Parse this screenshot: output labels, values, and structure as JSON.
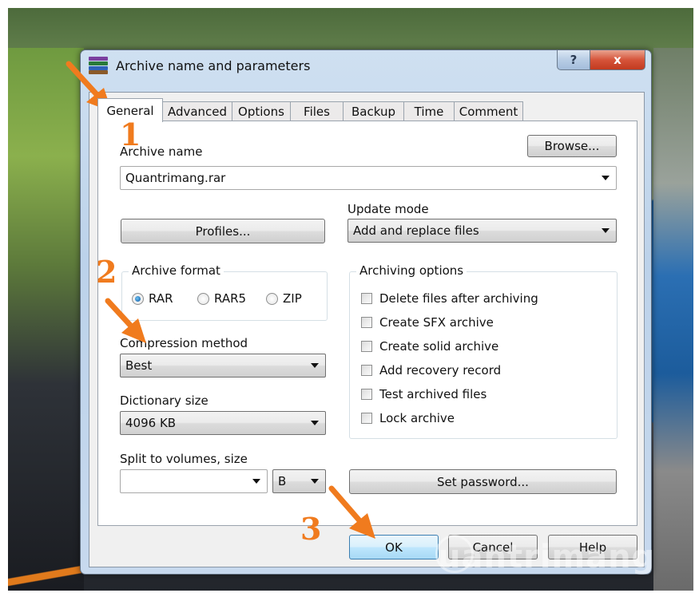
{
  "dialog": {
    "title": "Archive name and parameters",
    "help_label": "?",
    "close_label": "x"
  },
  "tabs": [
    "General",
    "Advanced",
    "Options",
    "Files",
    "Backup",
    "Time",
    "Comment"
  ],
  "general": {
    "archive_name_label": "Archive name",
    "browse_label": "Browse...",
    "archive_name_value": "Quantrimang.rar",
    "profiles_label": "Profiles...",
    "update_mode_label": "Update mode",
    "update_mode_value": "Add and replace files",
    "archive_format_title": "Archive format",
    "formats": [
      "RAR",
      "RAR5",
      "ZIP"
    ],
    "selected_format": "RAR",
    "compression_label": "Compression method",
    "compression_value": "Best",
    "dictionary_label": "Dictionary size",
    "dictionary_value": "4096 KB",
    "split_label": "Split to volumes, size",
    "split_value": "",
    "split_unit": "B",
    "archiving_options_title": "Archiving options",
    "options": [
      "Delete files after archiving",
      "Create SFX archive",
      "Create solid archive",
      "Add recovery record",
      "Test archived files",
      "Lock archive"
    ],
    "set_password_label": "Set password..."
  },
  "footer": {
    "ok_label": "OK",
    "cancel_label": "Cancel",
    "help_label": "Help"
  },
  "annotations": {
    "step1": "1",
    "step2": "2",
    "step3": "3",
    "color": "#f07b1e"
  },
  "watermark": "uantrimang"
}
